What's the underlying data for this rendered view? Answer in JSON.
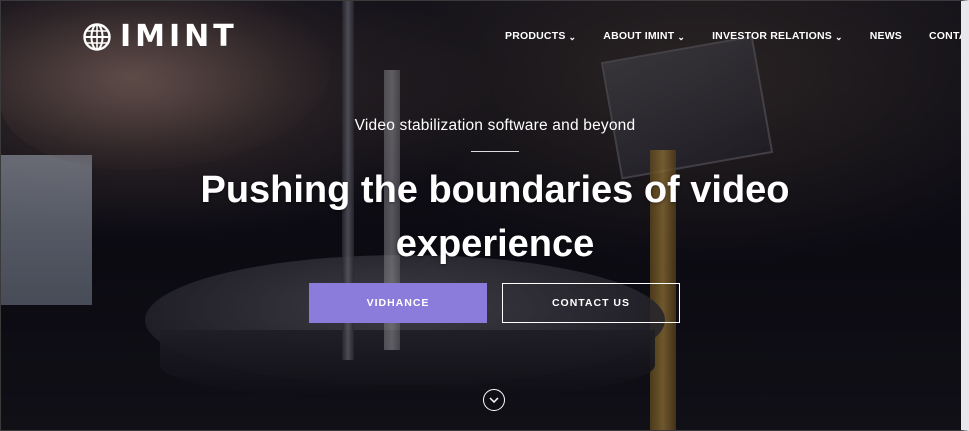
{
  "header": {
    "logo_text": "IMINT",
    "logo_icon": "globe-icon"
  },
  "nav": {
    "items": [
      {
        "label": "PRODUCTS",
        "has_dropdown": true
      },
      {
        "label": "ABOUT IMINT",
        "has_dropdown": true
      },
      {
        "label": "INVESTOR RELATIONS",
        "has_dropdown": true
      },
      {
        "label": "NEWS",
        "has_dropdown": false
      },
      {
        "label": "CONTACT",
        "has_dropdown": false
      }
    ],
    "dropdown_glyph": "⌄"
  },
  "hero": {
    "subtitle": "Video stabilization software and beyond",
    "headline_line1": "Pushing the boundaries of video",
    "headline_line2": "experience",
    "primary_button": "VIDHANCE",
    "secondary_button": "CONTACT US",
    "scroll_icon": "chevron-down-icon"
  },
  "colors": {
    "accent": "#8b7cdb",
    "text": "#ffffff"
  }
}
